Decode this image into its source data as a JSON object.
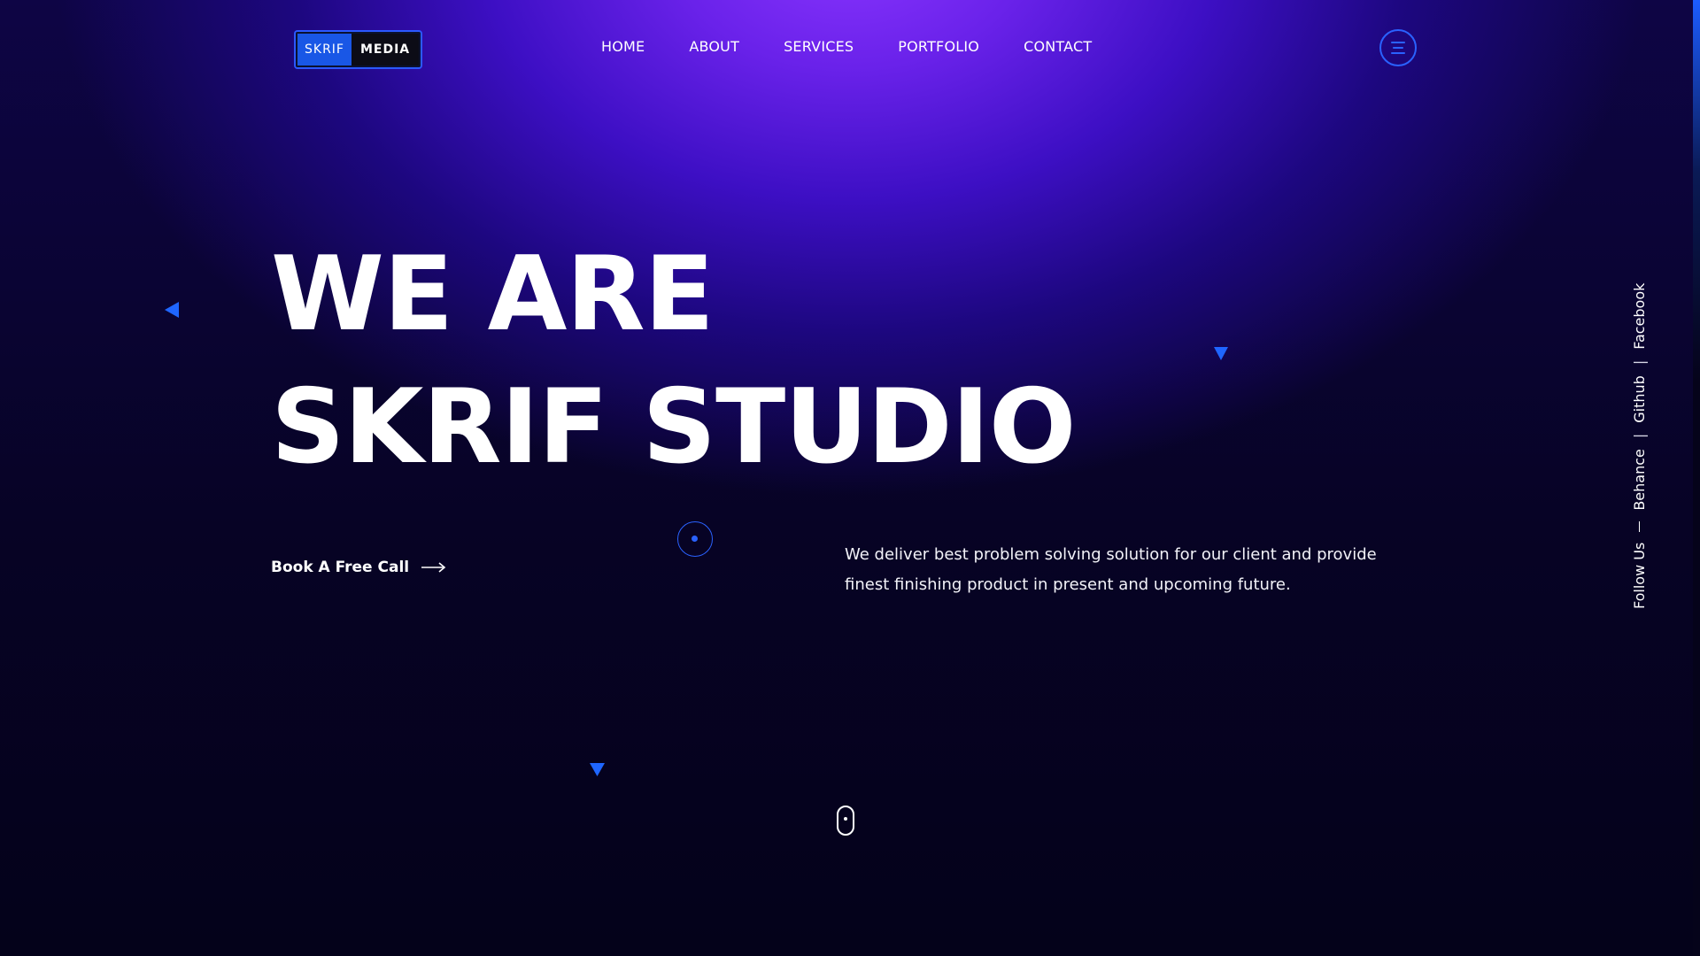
{
  "logo": {
    "part_a": "SKRIF",
    "part_b": "MEDIA"
  },
  "nav": {
    "items": [
      {
        "label": "HOME"
      },
      {
        "label": "ABOUT"
      },
      {
        "label": "SERVICES"
      },
      {
        "label": "PORTFOLIO"
      },
      {
        "label": "CONTACT"
      }
    ]
  },
  "menu_button": {
    "icon": "hamburger-menu-icon"
  },
  "hero": {
    "title_line1": "WE ARE",
    "title_line2": "SKRIF STUDIO",
    "cta_label": "Book A Free Call",
    "description": "We deliver best problem solving solution for our client and provide finest finishing product in present and upcoming future."
  },
  "social": {
    "label": "Follow Us",
    "separator": "|",
    "links": [
      {
        "label": "Behance"
      },
      {
        "label": "Github"
      },
      {
        "label": "Facebook"
      }
    ]
  },
  "colors": {
    "accent": "#2a62ff",
    "background": "#05031a",
    "glow": "#8a35ff",
    "text": "#ffffff"
  }
}
